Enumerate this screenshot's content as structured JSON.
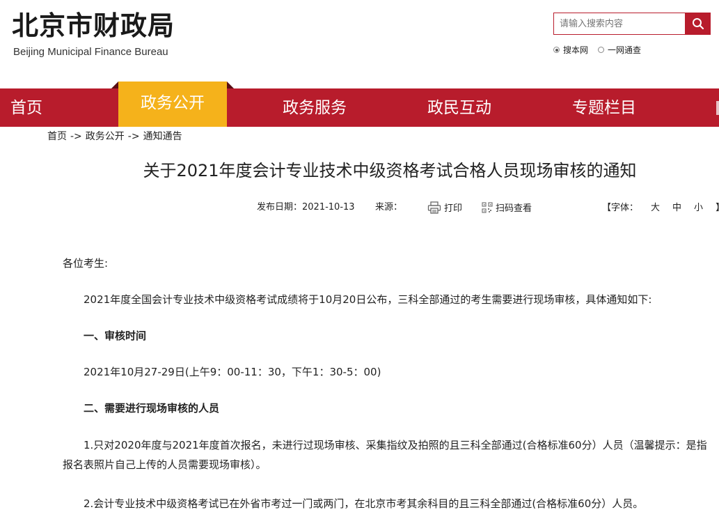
{
  "header": {
    "logo_cn": "北京市财政局",
    "logo_en": "Beijing Municipal Finance Bureau",
    "search_placeholder": "请输入搜索内容",
    "scope_site": "搜本网",
    "scope_gov": "一网通查"
  },
  "nav": {
    "items": [
      "首页",
      "政务公开",
      "政务服务",
      "政民互动",
      "专题栏目"
    ],
    "active": "政务公开"
  },
  "breadcrumb": [
    "首页",
    "政务公开",
    "通知通告"
  ],
  "breadcrumb_sep": "->",
  "article": {
    "title": "关于2021年度会计专业技术中级资格考试合格人员现场审核的通知",
    "date_label": "发布日期：",
    "date": "2021-10-13",
    "source_label": "来源：",
    "print_label": "打印",
    "qr_label": "扫码查看",
    "font_label": "【字体：",
    "font_large": "大",
    "font_medium": "中",
    "font_small": "小",
    "font_close": "】",
    "greeting": "各位考生:",
    "intro": "2021年度全国会计专业技术中级资格考试成绩将于10月20日公布，三科全部通过的考生需要进行现场审核，具体通知如下:",
    "h1": "一、审核时间",
    "time": "2021年10月27-29日(上午9：00-11：30，下午1：30-5：00)",
    "h2": "二、需要进行现场审核的人员",
    "item1": "1.只对2020年度与2021年度首次报名，未进行过现场审核、采集指纹及拍照的且三科全部通过(合格标准60分）人员（温馨提示：是指报名表照片自己上传的人员需要现场审核）。",
    "item2": "2.会计专业技术中级资格考试已在外省市考过一门或两门，在北京市考其余科目的且三科全部通过(合格标准60分）人员。"
  },
  "colors": {
    "brand_red": "#b81c2c",
    "active_tab": "#f5b21b"
  }
}
